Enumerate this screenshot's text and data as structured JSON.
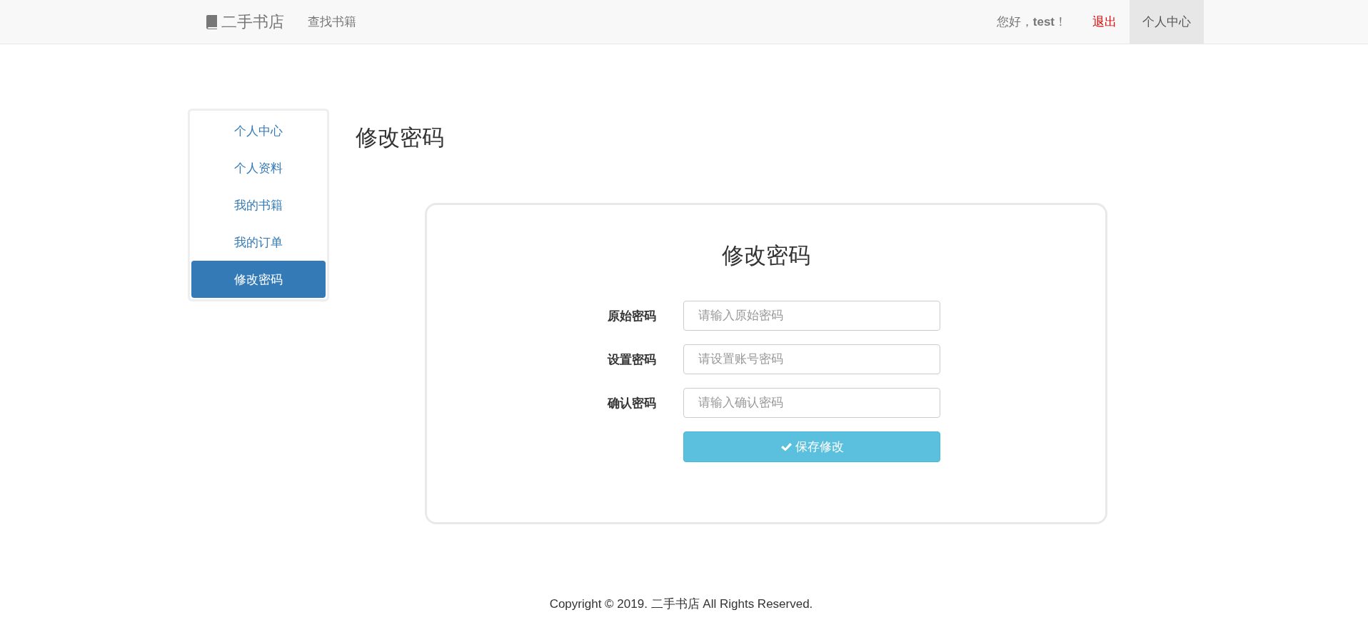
{
  "navbar": {
    "brand": "二手书店",
    "links": [
      {
        "label": "查找书籍"
      }
    ],
    "greeting": "您好，**test**！",
    "logout": "退出",
    "account": {
      "label": "个人中心",
      "selected": true
    }
  },
  "sidebar": {
    "items": [
      {
        "label": "个人中心",
        "selected": false
      },
      {
        "label": "个人资料",
        "selected": false
      },
      {
        "label": "我的书籍",
        "selected": false
      },
      {
        "label": "我的订单",
        "selected": false
      },
      {
        "label": "修改密码",
        "selected": true
      }
    ]
  },
  "page_title": "修改密码",
  "form": {
    "title": "修改密码",
    "fields": [
      {
        "label": "原始密码",
        "placeholder": "请输入原始密码"
      },
      {
        "label": "设置密码",
        "placeholder": "请设置账号密码"
      },
      {
        "label": "确认密码",
        "placeholder": "请输入确认密码"
      }
    ],
    "submit": "保存修改"
  },
  "footer": "Copyright © 2019. 二手书店 All Rights Reserved."
}
